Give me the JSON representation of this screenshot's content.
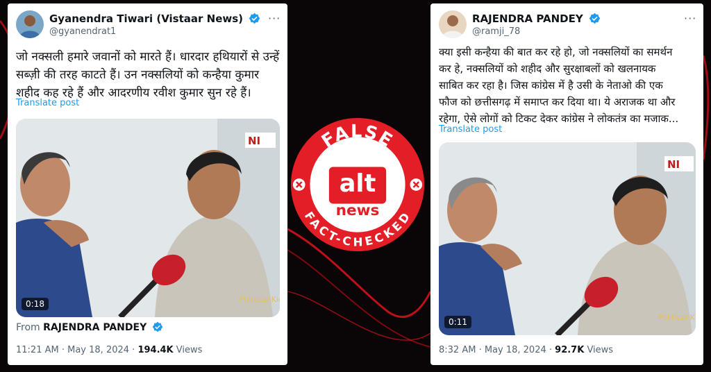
{
  "colors": {
    "background": "#0a0506",
    "accent_red": "#e41e26",
    "twitter_blue": "#1d9bf0",
    "text_primary": "#0f1419",
    "text_secondary": "#536471"
  },
  "left_tweet": {
    "author_name": "Gyanendra Tiwari (Vistaar News)",
    "handle": "@gyanendrat1",
    "text_lines": [
      "जो नक्सली हमारे जवानों को मारते हैं। धारदार हथियारों से उन्हें",
      "सब्ज़ी की तरह काटते हैं। उन नक्सलियों को कन्हैया कुमार",
      "शहीद कह रहे हैं और आदरणीय रवीश कुमार सुन रहे हैं।"
    ],
    "translate_label": "Translate post",
    "video_duration": "0:18",
    "video_watermark": "Political Kida",
    "from_prefix": "From",
    "from_author": "RAJENDRA PANDEY",
    "time": "11:21 AM",
    "date": "May 18, 2024",
    "views_count": "194.4K",
    "views_label": "Views"
  },
  "right_tweet": {
    "author_name": "RAJENDRA PANDEY",
    "handle": "@ramji_78",
    "text_lines": [
      "क्या इसी कन्हैया की बात कर रहे हो, जो नक्सलियों का समर्थन",
      "कर हे, नक्सलियों को शहीद और सुरक्षाबलों को खलनायक",
      "साबित कर रहा है। जिस कांग्रेस में है उसी के नेताओ की एक",
      "फौज को छत्तीसगढ़ में समाप्त कर दिया था। ये अराजक था और",
      "रहेगा, ऐसे लोगों को टिकट देकर कांग्रेस ने लोकतंत्र का मजाक..."
    ],
    "translate_label": "Translate post",
    "video_duration": "0:11",
    "video_watermark": "Political Kida",
    "time": "8:32 AM",
    "date": "May 18, 2024",
    "views_count": "92.7K",
    "views_label": "Views"
  },
  "badge": {
    "top_text": "FALSE",
    "logo_top": "alt",
    "logo_bottom": "news",
    "bottom_text": "FACT-CHECKED",
    "icon": "x-circle-icon"
  }
}
